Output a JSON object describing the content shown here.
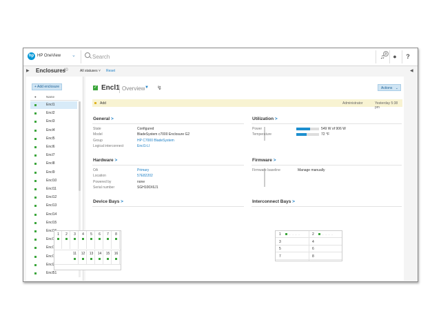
{
  "app": {
    "name": "HP OneView",
    "logo_text": "hp"
  },
  "topbar": {
    "search_placeholder": "Search",
    "notification_count": "2",
    "user_icon": "user-icon",
    "help_label": "?"
  },
  "header": {
    "title": "Enclosures",
    "count": "40",
    "status_filter": "All statuses ˅",
    "reset": "Reset"
  },
  "left_panel": {
    "add_button": "+ Add enclosure",
    "col_status": "●",
    "col_name": "Name",
    "items": [
      "Encl1",
      "Encl2",
      "Encl3",
      "Encl4",
      "Encl5",
      "Encl6",
      "Encl7",
      "Encl8",
      "Encl9",
      "Encl10",
      "Encl11",
      "Encl12",
      "Encl13",
      "Encl14",
      "Encl15",
      "Encl16",
      "Encl17",
      "Encl18",
      "Encl19",
      "Encl20",
      "Encl51"
    ],
    "selected_index": 0
  },
  "main": {
    "title": "Encl1",
    "view": "Overview",
    "actions": "Actions",
    "alert": {
      "text": "Add",
      "user": "Administrator",
      "time": "Yesterday 5:38 pm"
    },
    "general": {
      "title": "General",
      "rows": [
        {
          "label": "State",
          "value": "Configured",
          "link": false
        },
        {
          "label": "Model",
          "value": "BladeSystem c7000 Enclosure G2",
          "link": false
        },
        {
          "label": "Group",
          "value": "HP C7000 BladeSystem",
          "link": true
        },
        {
          "label": "Logical interconnect",
          "value": "Encl1-LI",
          "link": true
        }
      ]
    },
    "utilization": {
      "title": "Utilization",
      "rows": [
        {
          "label": "Power",
          "value": "549 W of 906 W",
          "fraction": 0.61
        },
        {
          "label": "Temperature",
          "value": "72 °F",
          "fraction": 0.45
        }
      ]
    },
    "hardware": {
      "title": "Hardware",
      "rows": [
        {
          "label": "OA",
          "value": "Primary",
          "link": true
        },
        {
          "label": "Location",
          "value": "57E82202",
          "link": true
        },
        {
          "label": "Powered by",
          "value": "none",
          "link": false
        },
        {
          "label": "Serial number",
          "value": "SGH100X6J1",
          "link": false
        }
      ]
    },
    "firmware": {
      "title": "Firmware",
      "rows": [
        {
          "label": "Firmware baseline",
          "value": "Manage manually"
        }
      ]
    },
    "device_bays": {
      "title": "Device Bays",
      "top": [
        "1",
        "2",
        "3",
        "4",
        "5",
        "6",
        "7",
        "8"
      ],
      "bottom": [
        "11",
        "12",
        "13",
        "14",
        "15",
        "16"
      ]
    },
    "interconnect_bays": {
      "title": "Interconnect Bays",
      "bays": [
        "1",
        "2",
        "3",
        "4",
        "5",
        "6",
        "7",
        "8"
      ],
      "dash": "- - - -"
    }
  }
}
